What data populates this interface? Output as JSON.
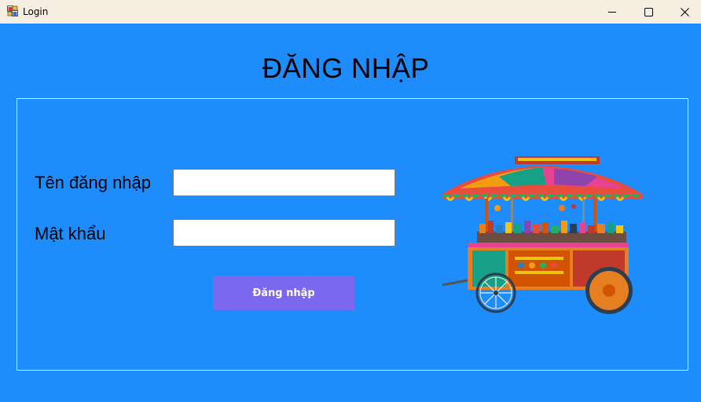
{
  "window": {
    "title": "Login",
    "controls": [
      "minimize-icon",
      "maximize-icon",
      "close-icon"
    ]
  },
  "form": {
    "heading": "ĐĂNG NHẬP",
    "username_label": "Tên đăng nhập",
    "username_value": "",
    "password_label": "Mật khẩu",
    "password_value": "",
    "login_button_label": "Đăng nhập"
  },
  "image": {
    "icon": "food-cart-image"
  },
  "colors": {
    "background": "#1e8cfa",
    "titlebar": "#f6eee1",
    "button": "#7b68ee",
    "button_text": "#ffffff"
  }
}
